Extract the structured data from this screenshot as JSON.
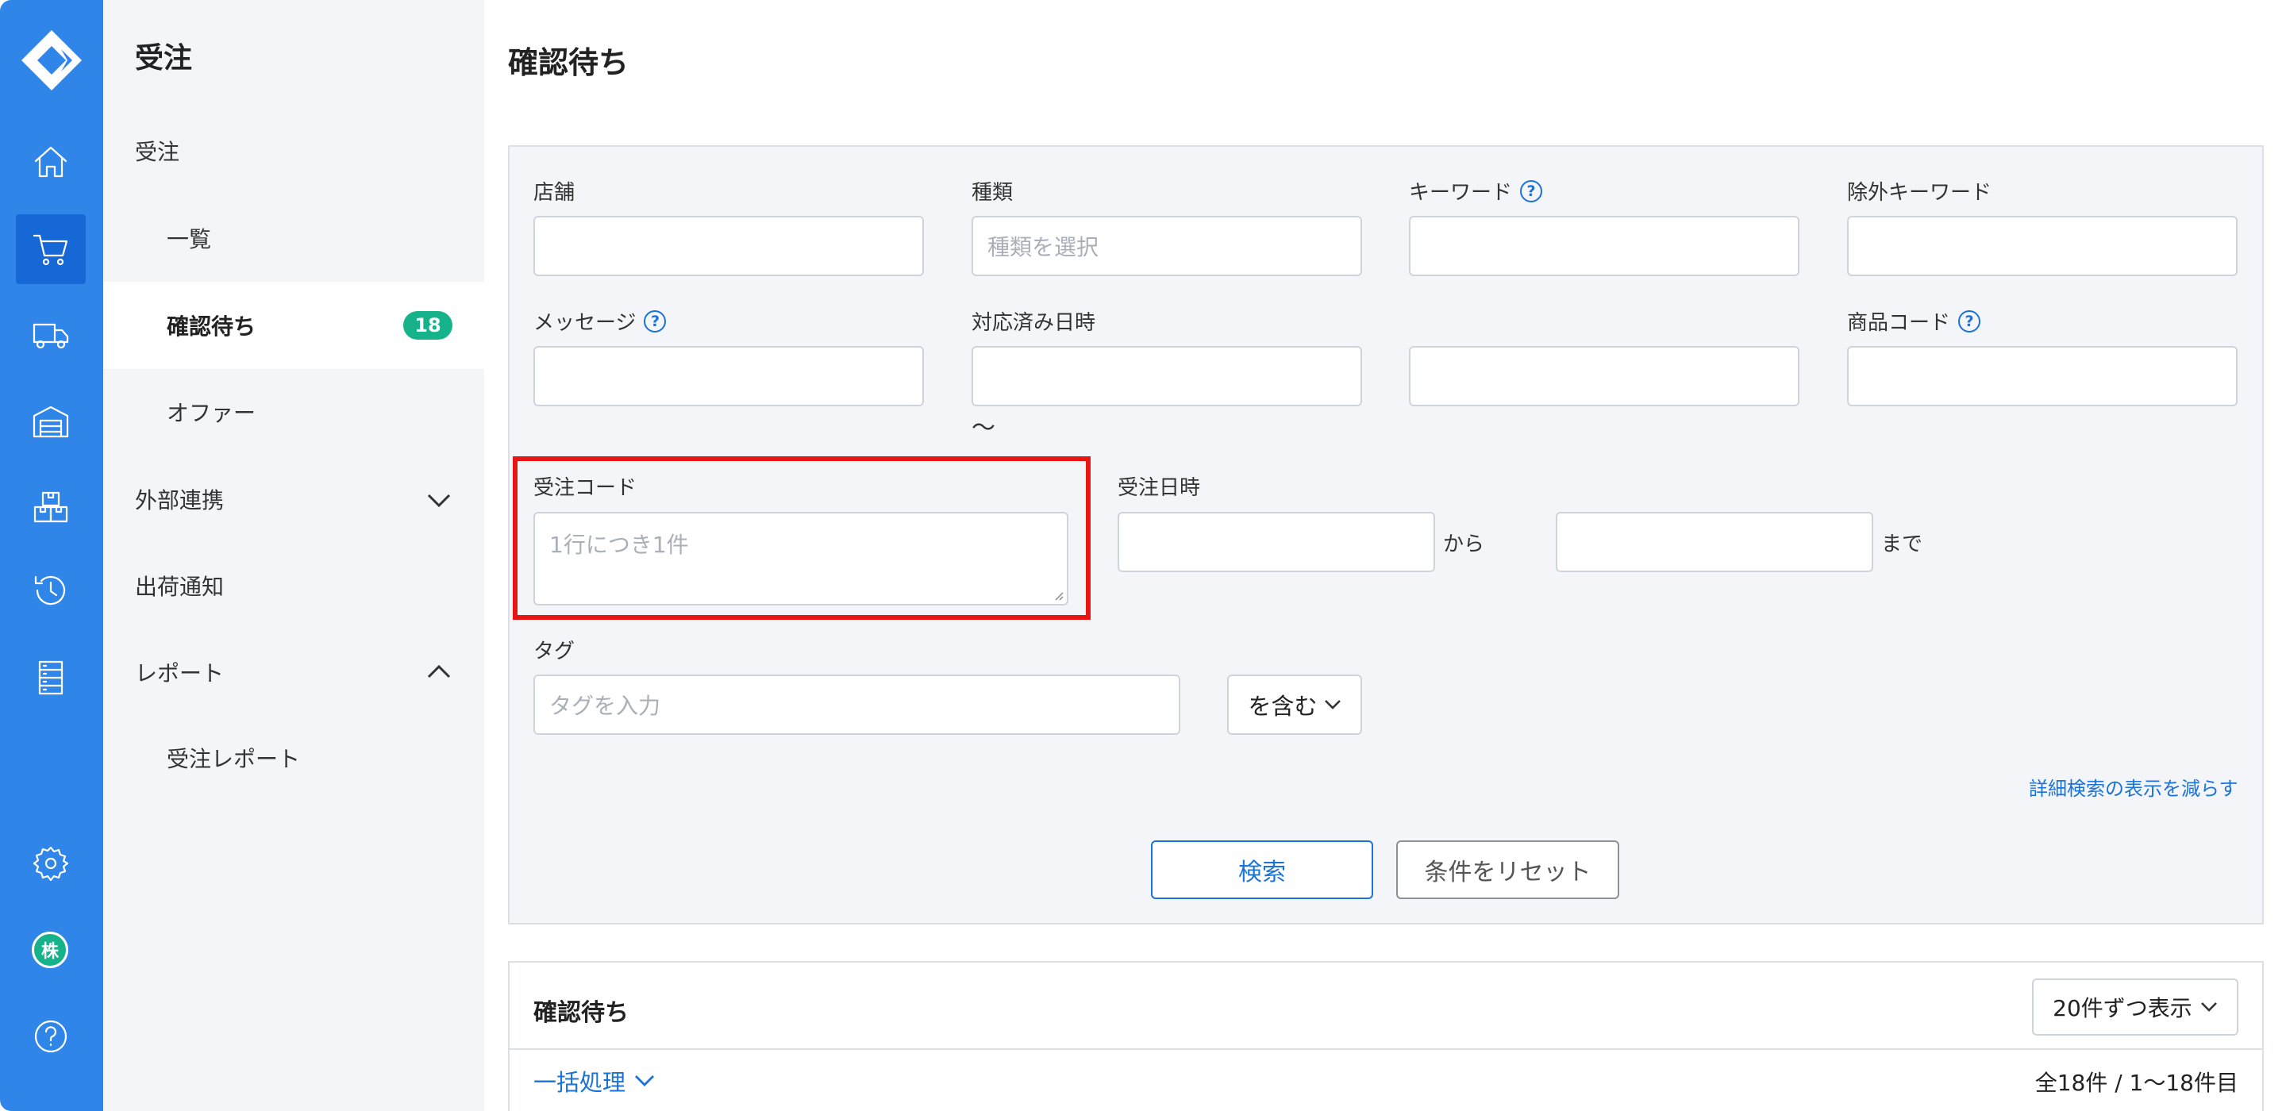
{
  "sidebar": {
    "icons": [
      "logo-icon",
      "home-icon",
      "cart-icon",
      "truck-icon",
      "warehouse-icon",
      "boxes-icon",
      "history-icon",
      "database-icon",
      "gear-icon",
      "company-icon",
      "help-icon"
    ],
    "avatar_label": "株",
    "help_label": "?"
  },
  "subnav": {
    "title": "受注",
    "items": [
      {
        "label": "受注"
      },
      {
        "label": "一覧"
      },
      {
        "label": "確認待ち",
        "badge": "18"
      },
      {
        "label": "オファー"
      },
      {
        "label": "外部連携"
      },
      {
        "label": "出荷通知"
      },
      {
        "label": "レポート"
      },
      {
        "label": "受注レポート"
      }
    ]
  },
  "main": {
    "title": "確認待ち"
  },
  "search": {
    "store_label": "店舗",
    "type_label": "種類",
    "type_placeholder": "種類を選択",
    "keyword_label": "キーワード",
    "exclude_keyword_label": "除外キーワード",
    "message_label": "メッセージ",
    "handled_date_label": "対応済み日時",
    "tilde": "〜",
    "product_code_label": "商品コード",
    "order_code_label": "受注コード",
    "order_code_placeholder": "1行につき1件",
    "order_date_label": "受注日時",
    "from_label": "から",
    "to_label": "まで",
    "tag_label": "タグ",
    "tag_placeholder": "タグを入力",
    "tag_match": "を含む",
    "reduce_link": "詳細検索の表示を減らす",
    "search_button": "検索",
    "reset_button": "条件をリセット",
    "help_mark": "?"
  },
  "results": {
    "title": "確認待ち",
    "per_page": "20件ずつ表示",
    "bulk_action": "一括処理",
    "count": "全18件 / 1〜18件目"
  },
  "colors": {
    "rail": "#2f86e8",
    "rail_active": "#1668d6",
    "accent": "#1a73d9",
    "badge": "#16b28a",
    "highlight": "#e81515"
  }
}
